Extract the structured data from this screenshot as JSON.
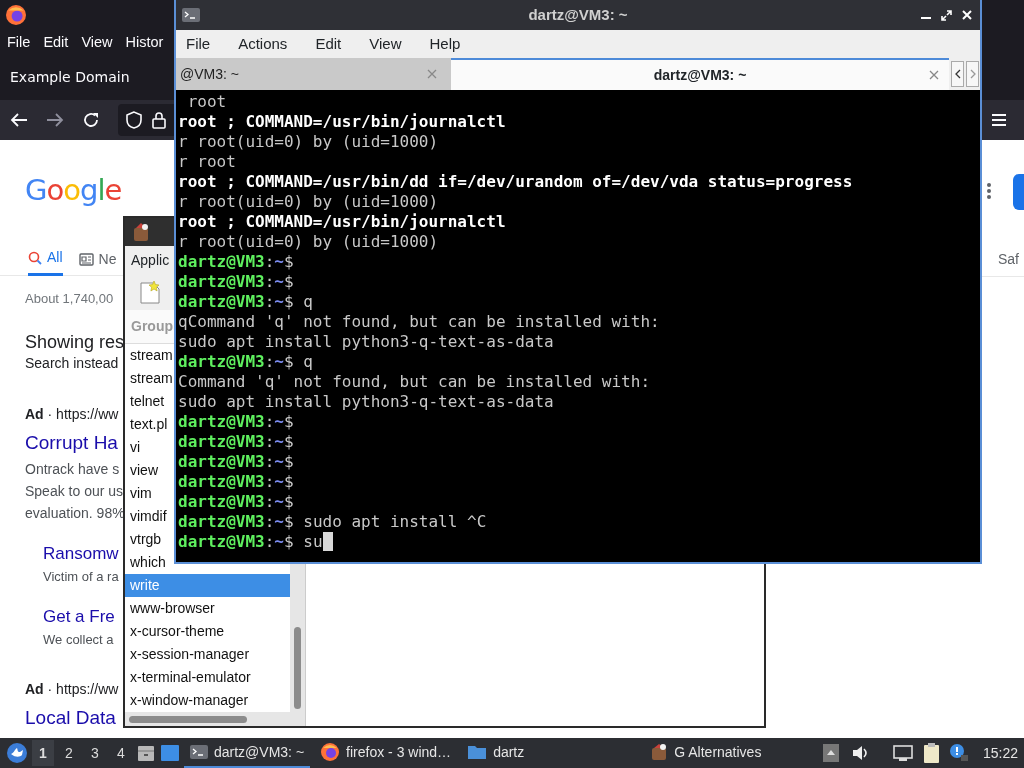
{
  "browser": {
    "menu": [
      "File",
      "Edit",
      "View",
      "Histor"
    ],
    "tab_title": "Example Domain",
    "logo": "Google",
    "search_tabs": [
      {
        "label": "All",
        "selected": true
      },
      {
        "label": "Ne",
        "selected": false
      }
    ],
    "right_tab": "Saf",
    "result_count": "About 1,740,00",
    "correction": "Showing res",
    "search_instead": "Search instead",
    "results": [
      {
        "kind": "ad",
        "text": "**Ad** · https://ww"
      },
      {
        "kind": "title",
        "text": "Corrupt Ha"
      },
      {
        "kind": "snippet",
        "text": "Ontrack have s"
      },
      {
        "kind": "snippet",
        "text": "Speak to our us"
      },
      {
        "kind": "snippet",
        "text": "evaluation. 98%"
      },
      {
        "kind": "sitelink",
        "text": "Ransomw"
      },
      {
        "kind": "sitelink-snippet",
        "text": "Victim of a ra"
      },
      {
        "kind": "sitelink",
        "text": "Get a Fre"
      },
      {
        "kind": "sitelink-snippet",
        "text": "We collect a"
      },
      {
        "kind": "ad",
        "text": "**Ad** · https://ww"
      },
      {
        "kind": "title",
        "text": "Local Data"
      }
    ]
  },
  "alternatives": {
    "menu": "Applic",
    "column": "Group",
    "items": [
      {
        "label": "stream",
        "selected": false
      },
      {
        "label": "stream",
        "selected": false
      },
      {
        "label": "telnet",
        "selected": false
      },
      {
        "label": "text.pl",
        "selected": false
      },
      {
        "label": "vi",
        "selected": false
      },
      {
        "label": "view",
        "selected": false
      },
      {
        "label": "vim",
        "selected": false
      },
      {
        "label": "vimdif",
        "selected": false
      },
      {
        "label": "vtrgb",
        "selected": false
      },
      {
        "label": "which",
        "selected": false
      },
      {
        "label": "write",
        "selected": true
      },
      {
        "label": "www-browser",
        "selected": false
      },
      {
        "label": "x-cursor-theme",
        "selected": false
      },
      {
        "label": "x-session-manager",
        "selected": false
      },
      {
        "label": "x-terminal-emulator",
        "selected": false
      },
      {
        "label": "x-window-manager",
        "selected": false
      }
    ]
  },
  "terminal": {
    "title": "dartz@VM3: ~",
    "menu": [
      "File",
      "Actions",
      "Edit",
      "View",
      "Help"
    ],
    "tabs": [
      {
        "label": "@VM3: ~",
        "selected": false
      },
      {
        "label": "dartz@VM3: ~",
        "selected": true
      }
    ],
    "lines": [
      {
        "kind": "plain",
        "text": " root"
      },
      {
        "kind": "bold",
        "text": "root ; COMMAND=/usr/bin/journalctl"
      },
      {
        "kind": "plain",
        "text": "r root(uid=0) by (uid=1000)"
      },
      {
        "kind": "plain",
        "text": "r root"
      },
      {
        "kind": "bold",
        "text": "root ; COMMAND=/usr/bin/dd if=/dev/urandom of=/dev/vda status=progress"
      },
      {
        "kind": "plain",
        "text": "r root(uid=0) by (uid=1000)"
      },
      {
        "kind": "bold",
        "text": "root ; COMMAND=/usr/bin/journalctl"
      },
      {
        "kind": "plain",
        "text": "r root(uid=0) by (uid=1000)"
      },
      {
        "kind": "prompt",
        "user": "dartz@VM3",
        "colon": ":",
        "path": "~",
        "dollar": "$"
      },
      {
        "kind": "prompt",
        "user": "dartz@VM3",
        "colon": ":",
        "path": "~",
        "dollar": "$"
      },
      {
        "kind": "prompt",
        "user": "dartz@VM3",
        "colon": ":",
        "path": "~",
        "dollar": "$",
        "command": "q"
      },
      {
        "kind": "plain",
        "text": "qCommand 'q' not found, but can be installed with:"
      },
      {
        "kind": "plain",
        "text": "sudo apt install python3-q-text-as-data"
      },
      {
        "kind": "prompt",
        "user": "dartz@VM3",
        "colon": ":",
        "path": "~",
        "dollar": "$",
        "command": "q"
      },
      {
        "kind": "plain",
        "text": "Command 'q' not found, but can be installed with:"
      },
      {
        "kind": "plain",
        "text": "sudo apt install python3-q-text-as-data"
      },
      {
        "kind": "prompt",
        "user": "dartz@VM3",
        "colon": ":",
        "path": "~",
        "dollar": "$"
      },
      {
        "kind": "prompt",
        "user": "dartz@VM3",
        "colon": ":",
        "path": "~",
        "dollar": "$"
      },
      {
        "kind": "prompt",
        "user": "dartz@VM3",
        "colon": ":",
        "path": "~",
        "dollar": "$"
      },
      {
        "kind": "prompt",
        "user": "dartz@VM3",
        "colon": ":",
        "path": "~",
        "dollar": "$"
      },
      {
        "kind": "prompt",
        "user": "dartz@VM3",
        "colon": ":",
        "path": "~",
        "dollar": "$"
      },
      {
        "kind": "prompt",
        "user": "dartz@VM3",
        "colon": ":",
        "path": "~",
        "dollar": "$",
        "command": "sudo apt install ^C"
      },
      {
        "kind": "prompt",
        "user": "dartz@VM3",
        "colon": ":",
        "path": "~",
        "dollar": "$",
        "command": "su",
        "cursor": true
      }
    ]
  },
  "taskbar": {
    "workspaces": [
      {
        "label": "1",
        "selected": true
      },
      {
        "label": "2",
        "selected": false
      },
      {
        "label": "3",
        "selected": false
      },
      {
        "label": "4",
        "selected": false
      }
    ],
    "tasks": [
      {
        "label": "dartz@VM3: ~",
        "selected": true
      },
      {
        "label": "firefox - 3 wind…",
        "selected": false
      },
      {
        "label": "dartz",
        "selected": false
      },
      {
        "label": "G Alternatives",
        "selected": false
      }
    ],
    "clock": "15:22"
  }
}
